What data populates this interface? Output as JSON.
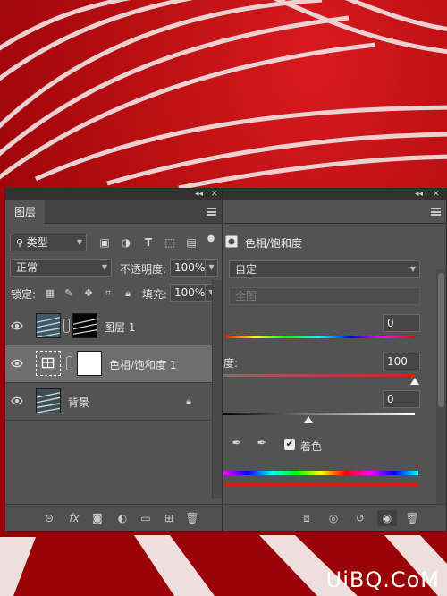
{
  "layers_panel": {
    "tab_label": "图层",
    "filter_kind": "类型",
    "blend_mode": "正常",
    "opacity_label": "不透明度:",
    "opacity_value": "100%",
    "lock_label": "锁定:",
    "fill_label": "填充:",
    "fill_value": "100%",
    "filter_icons": [
      "image-filter-icon",
      "adjustment-filter-icon",
      "type-filter-icon",
      "shape-filter-icon",
      "smart-object-filter-icon"
    ],
    "layers": [
      {
        "name": "图层 1",
        "visible": true,
        "selected": false,
        "has_mask": true
      },
      {
        "name": "色相/饱和度 1",
        "visible": true,
        "selected": true,
        "has_mask": true
      },
      {
        "name": "背景",
        "visible": true,
        "selected": false,
        "locked": true
      }
    ],
    "bottom_icons": [
      "link-layers-icon",
      "fx-icon",
      "add-mask-icon",
      "new-adjustment-icon",
      "new-group-icon",
      "new-layer-icon",
      "delete-layer-icon"
    ]
  },
  "properties_panel": {
    "title": "色相/饱和度",
    "preset": "自定",
    "channel": "全图",
    "hue_value": "0",
    "saturation_label": "度:",
    "saturation_value": "100",
    "lightness_value": "0",
    "colorize_label": "着色",
    "colorize_checked": true,
    "bottom_icons": [
      "clip-to-layer-icon",
      "view-previous-icon",
      "reset-icon",
      "visibility-icon",
      "delete-icon"
    ]
  },
  "watermark": "UiBQ.CoM",
  "colors": {
    "panel_bg": "#535353",
    "track_red": "#b0060b",
    "selected_row": "#6e6e6e"
  }
}
